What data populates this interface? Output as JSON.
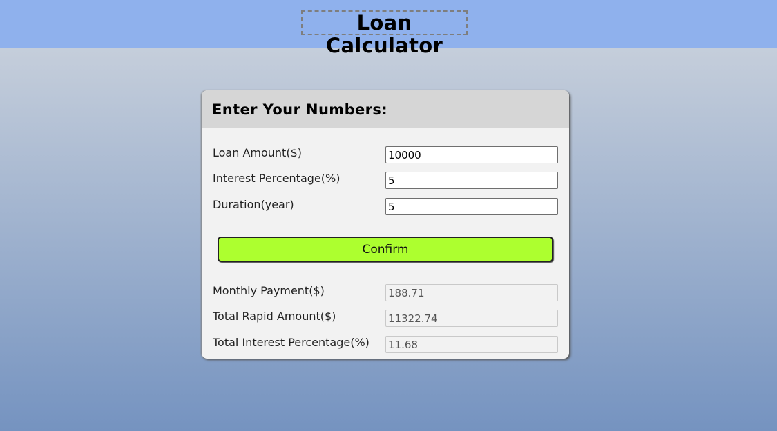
{
  "header": {
    "title": "Loan Calculator"
  },
  "form": {
    "heading": "Enter Your Numbers:",
    "inputs": [
      {
        "label": "Loan Amount($)",
        "value": "10000"
      },
      {
        "label": "Interest Percentage(%)",
        "value": "5"
      },
      {
        "label": "Duration(year)",
        "value": "5"
      }
    ],
    "confirm_label": "Confirm",
    "outputs": [
      {
        "label": "Monthly Payment($)",
        "value": "188.71"
      },
      {
        "label": "Total Rapid Amount($)",
        "value": "11322.74"
      },
      {
        "label": "Total Interest Percentage(%)",
        "value": "11.68"
      }
    ]
  },
  "colors": {
    "header_bg": "#8fb1ed",
    "button_bg": "#adff2f"
  }
}
